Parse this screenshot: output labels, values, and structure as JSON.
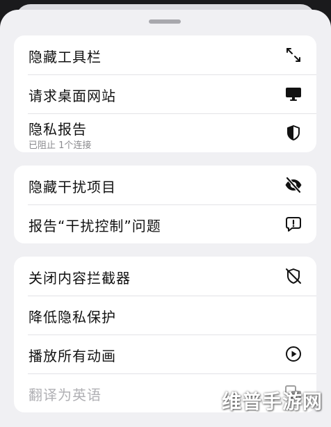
{
  "menu": {
    "group1": [
      {
        "label": "隐藏工具栏",
        "icon": "expand-arrows-icon"
      },
      {
        "label": "请求桌面网站",
        "icon": "desktop-icon"
      },
      {
        "label": "隐私报告",
        "sublabel": "已阻止 1个连接",
        "icon": "shield-half-icon"
      }
    ],
    "group2": [
      {
        "label": "隐藏干扰项目",
        "icon": "eye-slash-icon"
      },
      {
        "label": "报告“干扰控制”问题",
        "icon": "report-bubble-icon"
      }
    ],
    "group3": [
      {
        "label": "关闭内容拦截器",
        "icon": "shield-slash-icon"
      },
      {
        "label": "降低隐私保护"
      },
      {
        "label": "播放所有动画",
        "icon": "play-circle-icon"
      },
      {
        "label": "翻译为英语",
        "icon": "translate-icon"
      }
    ]
  },
  "watermark": "维普手游网"
}
